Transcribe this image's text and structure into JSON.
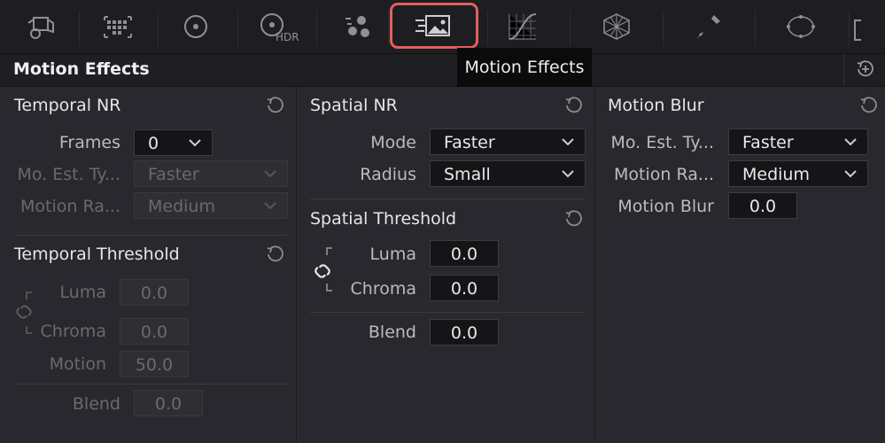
{
  "toolbar": {
    "icons": [
      "camera-raw-icon",
      "color-match-icon",
      "primaries-wheel-icon",
      "hdr-wheel-icon",
      "rgb-mixer-icon",
      "motion-effects-icon",
      "curves-icon",
      "color-warper-icon",
      "qualifier-eyedropper-icon",
      "window-circle-icon"
    ],
    "hdr_label": "HDR",
    "active_color": "#e2605d",
    "tooltip": "Motion Effects"
  },
  "header": {
    "title": "Motion Effects"
  },
  "temporal_nr": {
    "title": "Temporal NR",
    "frames_label": "Frames",
    "frames_value": "0",
    "mo_est_label": "Mo. Est. Ty...",
    "mo_est_value": "Faster",
    "motion_range_label": "Motion Ra...",
    "motion_range_value": "Medium"
  },
  "temporal_threshold": {
    "title": "Temporal Threshold",
    "luma_label": "Luma",
    "luma_value": "0.0",
    "chroma_label": "Chroma",
    "chroma_value": "0.0",
    "motion_label": "Motion",
    "motion_value": "50.0",
    "blend_label": "Blend",
    "blend_value": "0.0"
  },
  "spatial_nr": {
    "title": "Spatial NR",
    "mode_label": "Mode",
    "mode_value": "Faster",
    "radius_label": "Radius",
    "radius_value": "Small"
  },
  "spatial_threshold": {
    "title": "Spatial Threshold",
    "luma_label": "Luma",
    "luma_value": "0.0",
    "chroma_label": "Chroma",
    "chroma_value": "0.0",
    "blend_label": "Blend",
    "blend_value": "0.0"
  },
  "motion_blur": {
    "title": "Motion Blur",
    "mo_est_label": "Mo. Est. Ty...",
    "mo_est_value": "Faster",
    "motion_range_label": "Motion Ra...",
    "motion_range_value": "Medium",
    "blur_label": "Motion Blur",
    "blur_value": "0.0"
  }
}
